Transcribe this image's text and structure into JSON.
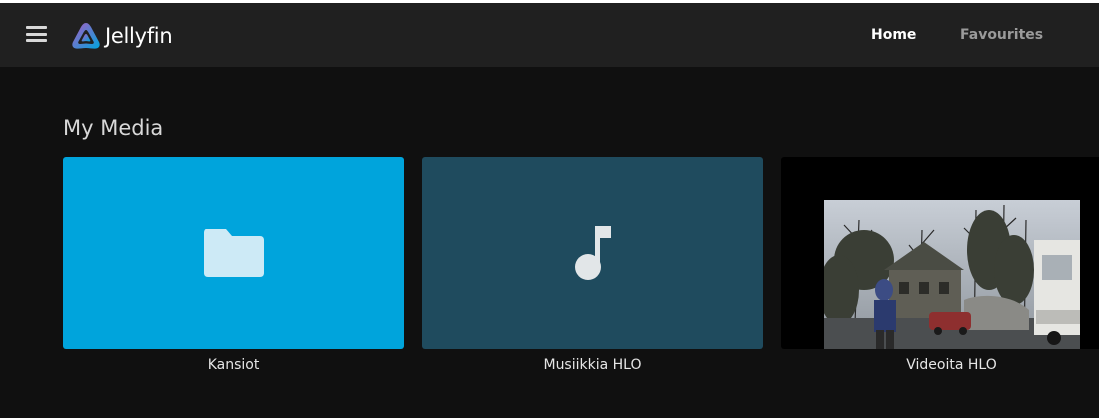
{
  "app": {
    "name": "Jellyfin"
  },
  "header": {
    "menu_icon": "hamburger-menu-icon",
    "tabs": [
      {
        "label": "Home",
        "active": true
      },
      {
        "label": "Favourites",
        "active": false
      }
    ]
  },
  "section": {
    "title": "My Media",
    "items": [
      {
        "label": "Kansiot",
        "icon": "folder-icon",
        "bg": "#00a4dc"
      },
      {
        "label": "Musiikkia HLO",
        "icon": "music-note-icon",
        "bg": "#1f4b5e"
      },
      {
        "label": "Videoita HLO",
        "icon": "video-thumbnail",
        "bg": "#000000"
      }
    ]
  },
  "colors": {
    "background": "#101010",
    "header": "#202020",
    "accent": "#00a4dc"
  }
}
